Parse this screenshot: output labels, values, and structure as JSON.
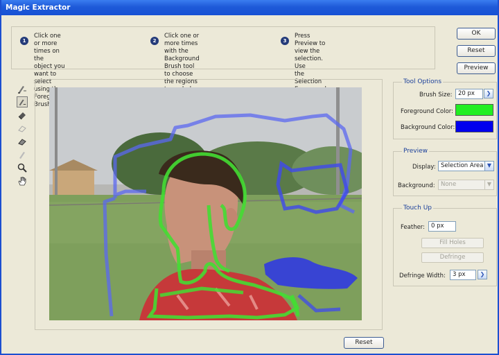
{
  "window": {
    "title": "Magic Extractor"
  },
  "steps": [
    {
      "num": "1",
      "text": "Click one or more times on the\nobject you want to select using the\nForeground Brush tool."
    },
    {
      "num": "2",
      "text": "Click one or more times with the\nBackground Brush tool to choose\nthe regions to exclude."
    },
    {
      "num": "3",
      "text": "Press Preview to view the selection. Use\nthe Selection Eraser and Smoothing\nBrush tools to fine-tune the selection."
    }
  ],
  "buttons": {
    "ok": "OK",
    "reset": "Reset",
    "preview": "Preview",
    "bottom_reset": "Reset"
  },
  "tools": [
    {
      "name": "foreground-brush-icon",
      "active": false
    },
    {
      "name": "background-brush-icon",
      "active": true
    },
    {
      "name": "point-eraser-icon",
      "active": false
    },
    {
      "name": "add-to-selection-icon",
      "active": false
    },
    {
      "name": "remove-from-selection-icon",
      "active": false
    },
    {
      "name": "smoothing-brush-icon",
      "active": false
    },
    {
      "name": "zoom-icon",
      "active": false
    },
    {
      "name": "hand-icon",
      "active": false
    }
  ],
  "tool_options": {
    "legend": "Tool Options",
    "brush_size_label": "Brush Size:",
    "brush_size_value": "20 px",
    "fg_label": "Foreground Color:",
    "fg_color": "#22ee22",
    "bg_label": "Background Color:",
    "bg_color": "#0000ee"
  },
  "preview": {
    "legend": "Preview",
    "display_label": "Display:",
    "display_value": "Selection Area",
    "background_label": "Background:",
    "background_value": "None"
  },
  "touchup": {
    "legend": "Touch Up",
    "feather_label": "Feather:",
    "feather_value": "0 px",
    "fill_holes": "Fill Holes",
    "defringe": "Defringe",
    "defringe_width_label": "Defringe Width:",
    "defringe_width_value": "3 px"
  },
  "colors": {
    "titlebar": "#1e5ad8",
    "fg_stroke": "#44dd33",
    "bg_stroke": "#3344ff"
  }
}
